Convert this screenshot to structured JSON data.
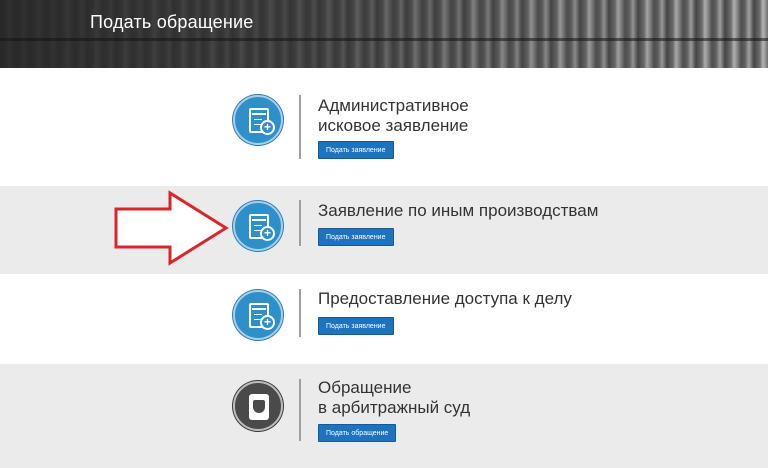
{
  "header": {
    "title": "Подать обращение"
  },
  "items": [
    {
      "title_line1": "Административное",
      "title_line2": "исковое заявление",
      "button_label": "Подать заявление",
      "icon": "document-plus-icon"
    },
    {
      "title_line1": "Заявление по иным производствам",
      "title_line2": "",
      "button_label": "Подать заявление",
      "icon": "document-plus-icon"
    },
    {
      "title_line1": "Предоставление доступа к делу",
      "title_line2": "",
      "button_label": "Подать заявление",
      "icon": "document-plus-icon"
    },
    {
      "title_line1": "Обращение",
      "title_line2": "в арбитражный суд",
      "button_label": "Подать обращение",
      "icon": "emblem-icon"
    }
  ],
  "colors": {
    "accent_blue": "#1d73be",
    "icon_blue": "#2f8fc9",
    "icon_dark": "#4a4a4a",
    "arrow_red": "#d9262b",
    "row_gray": "#ebebeb"
  }
}
